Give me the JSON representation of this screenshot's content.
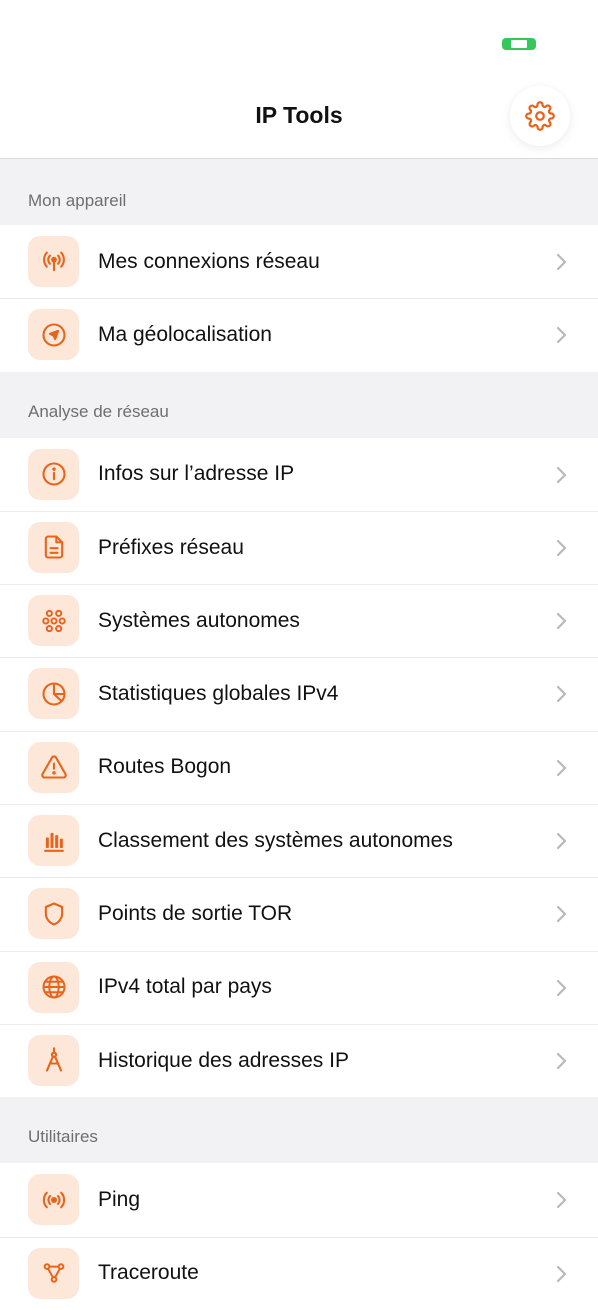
{
  "app": {
    "title": "IP Tools",
    "accent_color": "#e8641b",
    "icon_tile_color": "#fde7d9"
  },
  "status_bar": {
    "battery_color": "#34c759"
  },
  "nav": {
    "settings_icon": "gear-icon"
  },
  "sections": [
    {
      "header": "Mon appareil",
      "items": [
        {
          "label": "Mes connexions réseau",
          "icon": "antenna-icon"
        },
        {
          "label": "Ma géolocalisation",
          "icon": "location-arrow-icon"
        }
      ]
    },
    {
      "header": "Analyse de réseau",
      "items": [
        {
          "label": "Infos sur l’adresse IP",
          "icon": "info-icon"
        },
        {
          "label": "Préfixes réseau",
          "icon": "document-icon"
        },
        {
          "label": "Systèmes autonomes",
          "icon": "cluster-icon"
        },
        {
          "label": "Statistiques globales IPv4",
          "icon": "pie-chart-icon"
        },
        {
          "label": "Routes Bogon",
          "icon": "warning-icon"
        },
        {
          "label": "Classement des systèmes autonomes",
          "icon": "bar-chart-icon"
        },
        {
          "label": "Points de sortie TOR",
          "icon": "shield-icon"
        },
        {
          "label": "IPv4 total par pays",
          "icon": "globe-icon"
        },
        {
          "label": "Historique des adresses IP",
          "icon": "compass-icon"
        }
      ]
    },
    {
      "header": "Utilitaires",
      "items": [
        {
          "label": "Ping",
          "icon": "broadcast-icon"
        },
        {
          "label": "Traceroute",
          "icon": "route-nodes-icon"
        }
      ]
    }
  ]
}
